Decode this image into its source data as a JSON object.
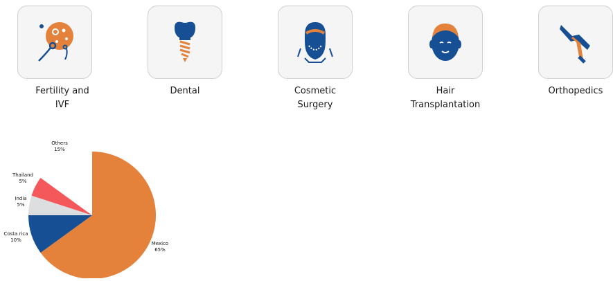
{
  "categories": [
    {
      "label": "Fertility and IVF",
      "icon": "fertility-icon"
    },
    {
      "label": "Dental",
      "icon": "dental-implant-icon"
    },
    {
      "label": "Cosmetic Surgery",
      "icon": "cosmetic-face-icon"
    },
    {
      "label": "Hair Transplantation",
      "icon": "hair-head-icon"
    },
    {
      "label": "Orthopedics",
      "icon": "knee-joint-icon"
    }
  ],
  "colors": {
    "orange": "#e4813b",
    "navy": "#164f93",
    "gray": "#dcdee0",
    "red": "#f4585a"
  },
  "chart_data": {
    "type": "pie",
    "slices": [
      {
        "label": "Mexico",
        "value": 65,
        "text": "65%",
        "color": "#e4813b"
      },
      {
        "label": "Costa rica",
        "value": 10,
        "text": "10%",
        "color": "#164f93"
      },
      {
        "label": "India",
        "value": 5,
        "text": "5%",
        "color": "#dcdee0"
      },
      {
        "label": "Thailand",
        "value": 5,
        "text": "5%",
        "color": "#f4585a"
      },
      {
        "label": "Others",
        "value": 15,
        "text": "15%",
        "color": "#ffffff"
      }
    ]
  }
}
